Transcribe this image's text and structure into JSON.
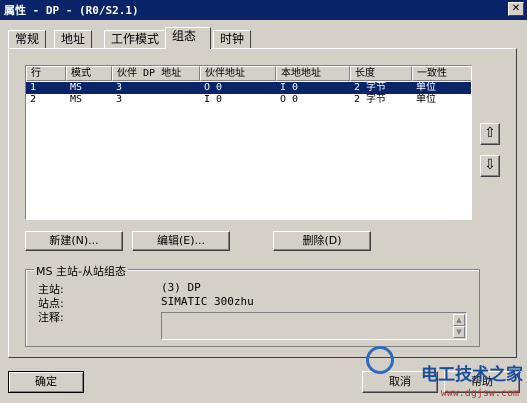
{
  "window": {
    "title": "属性 - DP - (R0/S2.1)",
    "close_glyph": "✕"
  },
  "tabs": [
    {
      "label": "常规",
      "active": false
    },
    {
      "label": "地址",
      "active": false
    },
    {
      "label": "工作模式",
      "active": false
    },
    {
      "label": "组态",
      "active": true
    },
    {
      "label": "时钟",
      "active": false
    }
  ],
  "table": {
    "headers": [
      "行",
      "模式",
      "伙伴 DP 地址",
      "伙伴地址",
      "本地地址",
      "长度",
      "一致性"
    ],
    "rows": [
      {
        "row": "1",
        "mode": "MS",
        "partner_dp": "3",
        "partner_addr": "O 0",
        "local_addr": "I 0",
        "length": "2 字节",
        "consistency": "单位",
        "selected": true
      },
      {
        "row": "2",
        "mode": "MS",
        "partner_dp": "3",
        "partner_addr": "I 0",
        "local_addr": "O 0",
        "length": "2 字节",
        "consistency": "单位",
        "selected": false
      }
    ]
  },
  "side_buttons": {
    "up_glyph": "⇧",
    "down_glyph": "⇩"
  },
  "actions": {
    "new_label": "新建(N)...",
    "edit_label": "编辑(E)...",
    "delete_label": "删除(D)"
  },
  "group": {
    "legend": "MS 主站-从站组态",
    "master_label": "主站:",
    "master_value": "(3) DP",
    "station_label": "站点:",
    "station_value": "SIMATIC 300zhu",
    "comment_label": "注释:",
    "comment_value": ""
  },
  "footer": {
    "ok_label": "确定",
    "cancel_label": "取消",
    "help_label": "帮助"
  },
  "watermark": {
    "text": "电工技术之家",
    "url": "www.dgjsw.com"
  },
  "colors": {
    "titlebar": "#0a246a",
    "face": "#d4d0c8",
    "selection": "#0a246a"
  }
}
